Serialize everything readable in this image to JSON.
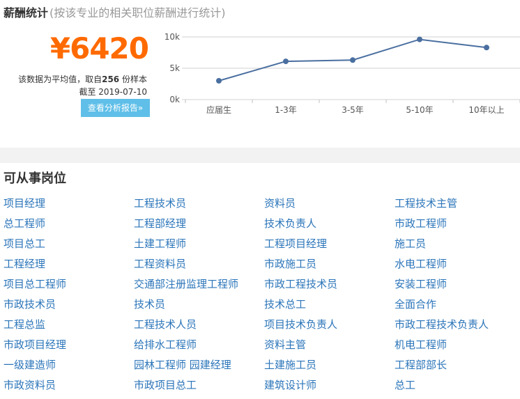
{
  "header": {
    "title": "薪酬统计",
    "subtitle": "(按该专业的相关职位薪酬进行统计)"
  },
  "salary": {
    "value": "¥6420",
    "note_prefix": "该数据为平均值，取自",
    "sample_count": "256",
    "note_suffix": " 份样本",
    "date_line": "截至 2019-07-10",
    "report_button": "查看分析报告»"
  },
  "chart_data": {
    "type": "line",
    "categories": [
      "应届生",
      "1-3年",
      "3-5年",
      "5-10年",
      "10年以上"
    ],
    "series": [
      {
        "values": [
          3000,
          6100,
          6300,
          9600,
          8300
        ]
      }
    ],
    "y_ticks": [
      "10k",
      "5k",
      "0k"
    ],
    "ylim": [
      0,
      10000
    ],
    "grid": true,
    "line_color": "#4a6fa0"
  },
  "jobs": {
    "title": "可从事岗位",
    "items": [
      "项目经理",
      "工程技术员",
      "资料员",
      "工程技术主管",
      "总工程师",
      "工程部经理",
      "技术负责人",
      "市政工程师",
      "项目总工",
      "土建工程师",
      "工程项目经理",
      "施工员",
      "工程经理",
      "工程资料员",
      "市政施工员",
      "水电工程师",
      "项目总工程师",
      "交通部注册监理工程师",
      "市政工程技术员",
      "安装工程师",
      "市政技术员",
      "技术员",
      "技术总工",
      "全面合作",
      "工程总监",
      "工程技术人员",
      "项目技术负责人",
      "市政工程技术负责人",
      "市政项目经理",
      "给排水工程师",
      "资料主管",
      "机电工程师",
      "一级建造师",
      "园林工程师 园建经理",
      "土建施工员",
      "工程部部长",
      "市政资料员",
      "市政项目总工",
      "建筑设计师",
      "总工"
    ]
  }
}
